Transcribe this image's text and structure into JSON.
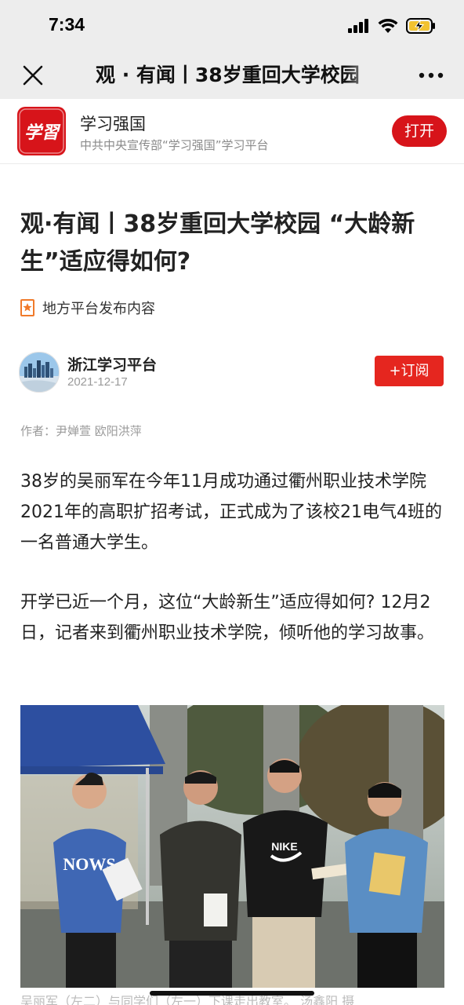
{
  "status": {
    "time": "7:34"
  },
  "nav": {
    "title": "观 · 有闻丨38岁重回大学校园"
  },
  "app": {
    "logo_text": "学習",
    "name": "学习强国",
    "desc": "中共中央宣传部“学习强国”学习平台",
    "open_label": "打开"
  },
  "article": {
    "title": "观·有闻丨38岁重回大学校园 “大龄新生”适应得如何?",
    "source_label": "地方平台发布内容",
    "author": "浙江学习平台",
    "date": "2021-12-17",
    "subscribe_label": "+订阅",
    "byline": "作者：尹婵萱 欧阳洪萍",
    "paragraphs": [
      "38岁的吴丽军在今年11月成功通过衢州职业技术学院2021年的高职扩招考试，正式成为了该校21电气4班的一名普通大学生。",
      "开学已近一个月，这位“大龄新生”适应得如何? 12月2日，记者来到衢州职业技术学院，倾听他的学习故事。"
    ],
    "photo": {
      "shirt_text": "NOWS",
      "brand_text": "NIKE"
    },
    "caption": "吴丽军（左二）与同学们（左一）下课走出教室。 汤鑫阳 摄"
  },
  "colors": {
    "brand_red": "#d7141a",
    "subscribe_red": "#e5261f",
    "bar_bg": "#ededed"
  }
}
